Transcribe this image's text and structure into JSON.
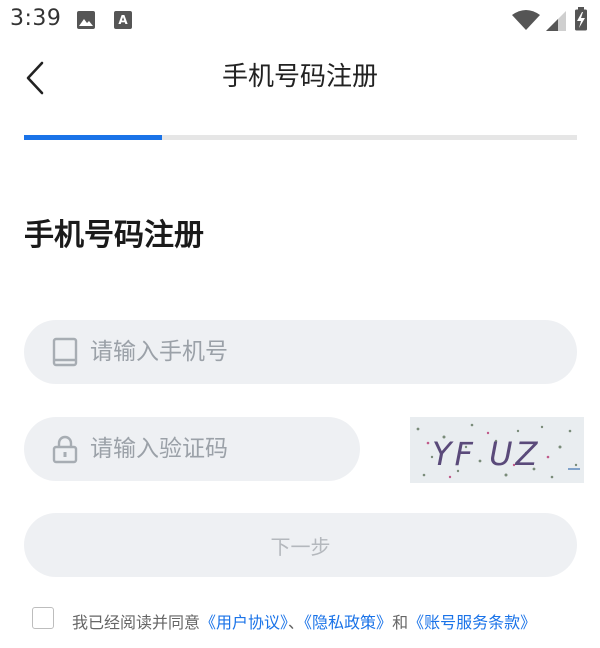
{
  "status_bar": {
    "time": "3:39",
    "icons": [
      "gallery-icon",
      "a-badge-icon",
      "wifi-icon",
      "cell-signal-icon",
      "battery-charging-icon"
    ]
  },
  "header": {
    "title": "手机号码注册",
    "back_icon": "chevron-left-icon"
  },
  "progress": {
    "value": 0.25,
    "color": "#1a73e8"
  },
  "page_title": "手机号码注册",
  "form": {
    "phone": {
      "placeholder": "请输入手机号",
      "value": "",
      "icon": "tablet-icon"
    },
    "code": {
      "placeholder": "请输入验证码",
      "value": "",
      "icon": "lock-icon"
    },
    "captcha": {
      "text": "YF UZ"
    },
    "next_label": "下一步"
  },
  "agreement": {
    "prefix": "我已经阅读并同意",
    "link1": "《用户协议》",
    "sep": "、",
    "link2": "《隐私政策》",
    "and": "和",
    "link3": "《账号服务条款》",
    "checked": false
  },
  "colors": {
    "accent": "#1a73e8",
    "field_bg": "#eef0f3",
    "placeholder": "#9ba1a8"
  }
}
